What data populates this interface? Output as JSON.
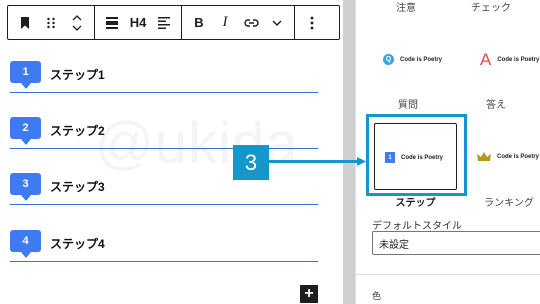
{
  "toolbar": {
    "heading_level": "H4",
    "bold_label": "B",
    "italic_label": "I"
  },
  "steps": [
    {
      "number": "1",
      "label": "ステップ1"
    },
    {
      "number": "2",
      "label": "ステップ2"
    },
    {
      "number": "3",
      "label": "ステップ3"
    },
    {
      "number": "4",
      "label": "ステップ4"
    }
  ],
  "add_block_label": "+",
  "watermark": "@ukida",
  "callout": {
    "number": "3"
  },
  "sidebar": {
    "styles": [
      {
        "label": "注意"
      },
      {
        "label": "チェック"
      },
      {
        "label": "質問",
        "preview_icon": "Q",
        "preview_text": "Code is Poetry"
      },
      {
        "label": "答え",
        "preview_icon": "A",
        "preview_text": "Code is Poetry"
      },
      {
        "label": "ステップ",
        "preview_icon": "1",
        "preview_text": "Code is Poetry",
        "selected": true
      },
      {
        "label": "ランキング",
        "preview_icon": "crown-icon",
        "preview_text": "Code is Poetry"
      }
    ],
    "default_style_label": "デフォルトスタイル",
    "default_style_value": "未設定",
    "color_section_label": "色"
  },
  "colors": {
    "accent": "#1597c9",
    "step_blue": "#3e7bf0",
    "divider": "#cfcfcf"
  }
}
